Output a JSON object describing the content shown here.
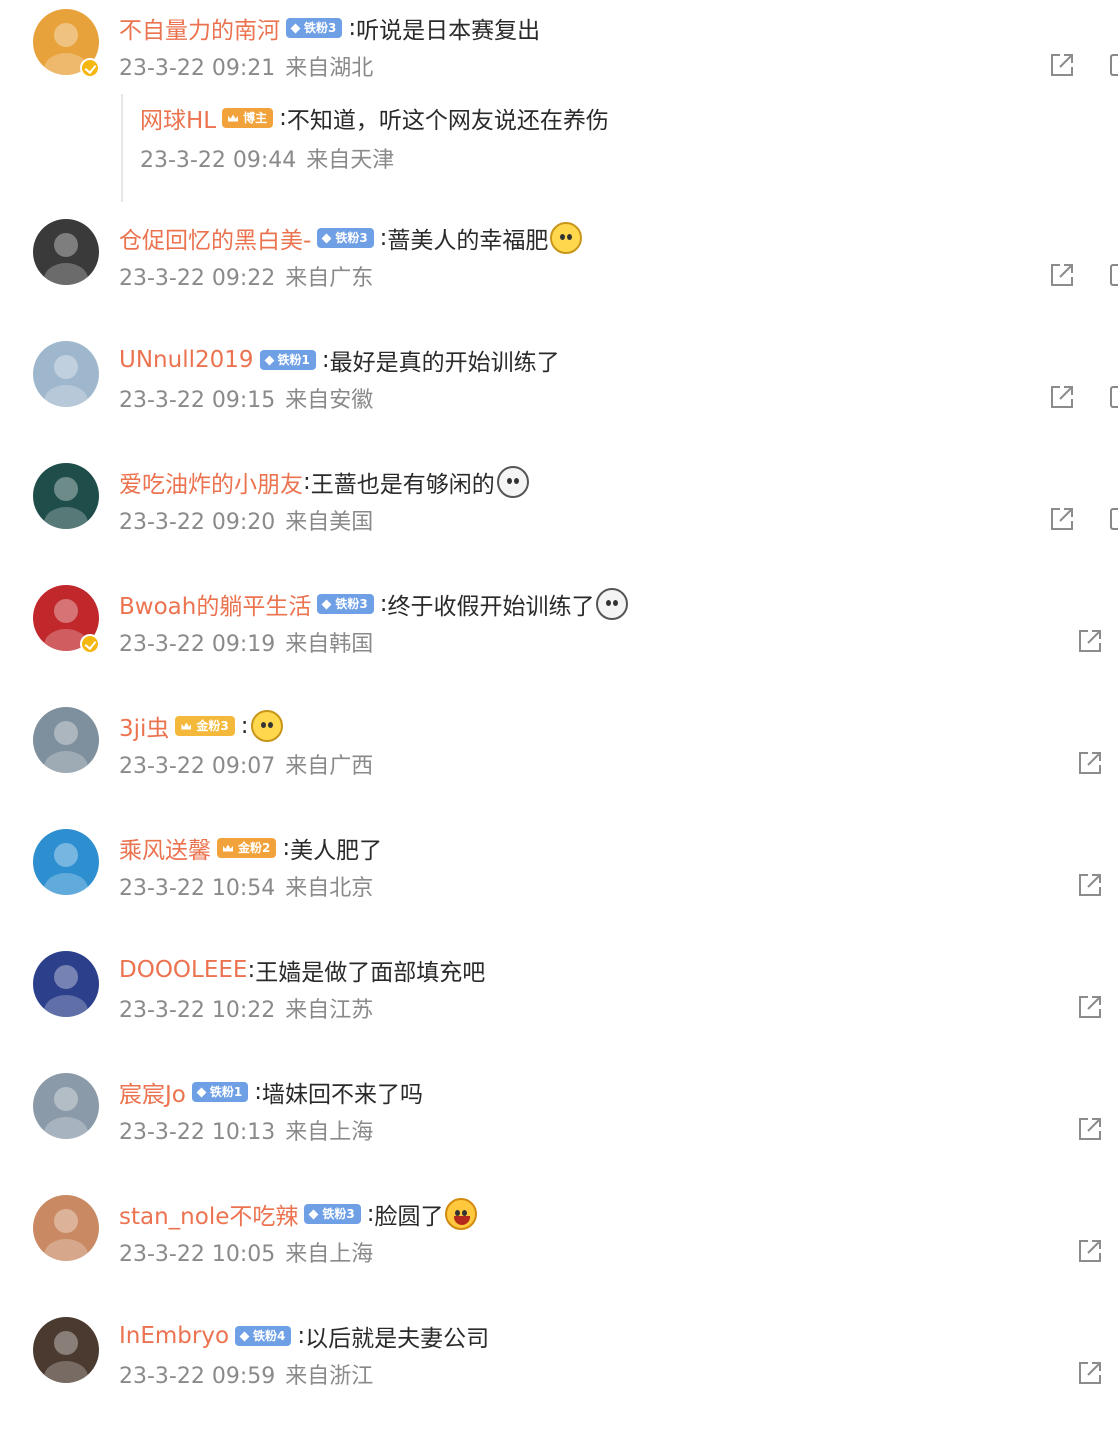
{
  "comments": [
    {
      "username": "不自量力的南河",
      "badge": {
        "label": "铁粉3",
        "style": "blue"
      },
      "separator": ":",
      "text": "听说是日本赛复出",
      "emoji": null,
      "verified": true,
      "time": "23-3-22 09:21",
      "location": "来自湖北",
      "avatar_color": "#e8a23b",
      "reply": {
        "username": "网球HL",
        "badge": {
          "label": "博主",
          "style": "orange"
        },
        "separator": ":",
        "text": "不知道，听这个网友说还在养伤",
        "time": "23-3-22 09:44",
        "location": "来自天津"
      }
    },
    {
      "username": "仓促回忆的黑白美-",
      "badge": {
        "label": "铁粉3",
        "style": "blue"
      },
      "separator": ":",
      "text": "蔷美人的幸福肥",
      "emoji": "doge-emoji",
      "verified": false,
      "time": "23-3-22 09:22",
      "location": "来自广东",
      "avatar_color": "#3a3a3a"
    },
    {
      "username": "UNnull2019",
      "badge": {
        "label": "铁粉1",
        "style": "blue"
      },
      "separator": ":",
      "text": "最好是真的开始训练了",
      "emoji": null,
      "verified": false,
      "time": "23-3-22 09:15",
      "location": "来自安徽",
      "avatar_color": "#9fb7cc"
    },
    {
      "username": "爱吃油炸的小朋友",
      "badge": null,
      "separator": ":",
      "text": "王蔷也是有够闲的",
      "emoji": "ghost-emoji",
      "verified": false,
      "time": "23-3-22 09:20",
      "location": "来自美国",
      "avatar_color": "#1f4d4a"
    },
    {
      "username": "Bwoah的躺平生活",
      "badge": {
        "label": "铁粉3",
        "style": "blue"
      },
      "separator": ":",
      "text": "终于收假开始训练了",
      "emoji": "ghost-emoji",
      "verified": true,
      "time": "23-3-22 09:19",
      "location": "来自韩国",
      "avatar_color": "#c0282c"
    },
    {
      "username": "3ji虫",
      "badge": {
        "label": "金粉3",
        "style": "gold"
      },
      "separator": ":",
      "text": "",
      "emoji": "smile-emoji",
      "verified": false,
      "time": "23-3-22 09:07",
      "location": "来自广西",
      "avatar_color": "#7e8f9d"
    },
    {
      "username": "乘风送馨",
      "badge": {
        "label": "金粉2",
        "style": "orange"
      },
      "separator": ":",
      "text": "美人肥了",
      "emoji": null,
      "verified": false,
      "time": "23-3-22 10:54",
      "location": "来自北京",
      "avatar_color": "#2d8fd0"
    },
    {
      "username": "DOOOLEEE",
      "badge": null,
      "separator": ":",
      "text": "王嫱是做了面部填充吧",
      "emoji": null,
      "verified": false,
      "time": "23-3-22 10:22",
      "location": "来自江苏",
      "avatar_color": "#2b3f8a"
    },
    {
      "username": "宸宸Jo",
      "badge": {
        "label": "铁粉1",
        "style": "blue"
      },
      "separator": ":",
      "text": "墙妹回不来了吗",
      "emoji": null,
      "verified": false,
      "time": "23-3-22 10:13",
      "location": "来自上海",
      "avatar_color": "#8a9aa8"
    },
    {
      "username": "stan_nole不吃辣",
      "badge": {
        "label": "铁粉3",
        "style": "blue"
      },
      "separator": ":",
      "text": "脸圆了",
      "emoji": "laugh-emoji",
      "verified": false,
      "time": "23-3-22 10:05",
      "location": "来自上海",
      "avatar_color": "#c98a63"
    },
    {
      "username": "InEmbryo",
      "badge": {
        "label": "铁粉4",
        "style": "blue"
      },
      "separator": ":",
      "text": "以后就是夫妻公司",
      "emoji": null,
      "verified": false,
      "time": "23-3-22 09:59",
      "location": "来自浙江",
      "avatar_color": "#4a3a30"
    }
  ]
}
